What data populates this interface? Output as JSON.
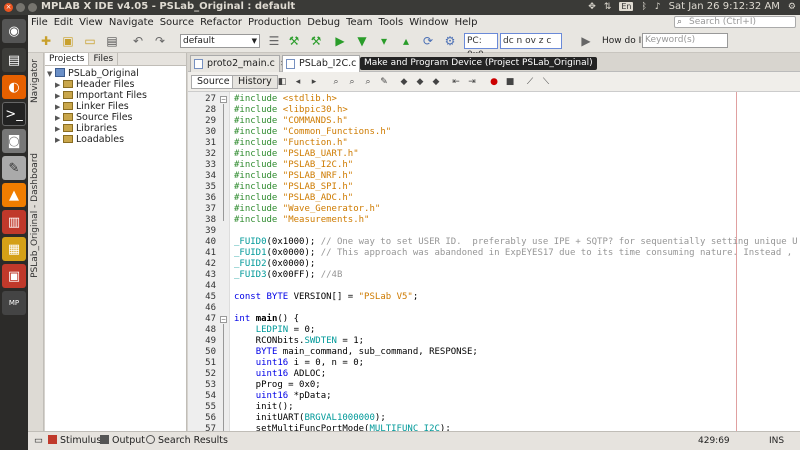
{
  "os_bar": {
    "window_title": "MPLAB X IDE v4.05 - PSLab_Original : default",
    "lang": "En",
    "clock": "Sat Jan 26  9:12:32 AM"
  },
  "menu": {
    "items": [
      "File",
      "Edit",
      "View",
      "Navigate",
      "Source",
      "Refactor",
      "Production",
      "Debug",
      "Team",
      "Tools",
      "Window",
      "Help"
    ],
    "search_placeholder": "Search (Ctrl+I)"
  },
  "toolbar": {
    "config_value": "default",
    "pc_label": "PC: 0x0",
    "status_bits": "dc n ov z c",
    "howdoi_label": "How do I?",
    "keyword_placeholder": "Keyword(s)"
  },
  "side_labels": {
    "navigator": "Navigator",
    "dashboard": "PSLab_Original - Dashboard"
  },
  "project_panel": {
    "tabs": [
      "Projects",
      "Files"
    ],
    "root": "PSLab_Original",
    "folders": [
      "Header Files",
      "Important Files",
      "Linker Files",
      "Source Files",
      "Libraries",
      "Loadables"
    ]
  },
  "editor": {
    "tabs": [
      "proto2_main.c",
      "PSLab_I2C.c"
    ],
    "tooltip": "Make and Program Device (Project PSLab_Original)",
    "view_buttons": [
      "Source",
      "History"
    ]
  },
  "code_lines": [
    {
      "n": "27",
      "t": [
        [
          "pp",
          "#include "
        ],
        [
          "str",
          "<stdlib.h>"
        ]
      ]
    },
    {
      "n": "28",
      "t": [
        [
          "pp",
          "#include "
        ],
        [
          "str",
          "<libpic30.h>"
        ]
      ]
    },
    {
      "n": "29",
      "t": [
        [
          "pp",
          "#include "
        ],
        [
          "str",
          "\"COMMANDS.h\""
        ]
      ]
    },
    {
      "n": "30",
      "t": [
        [
          "pp",
          "#include "
        ],
        [
          "str",
          "\"Common_Functions.h\""
        ]
      ]
    },
    {
      "n": "31",
      "t": [
        [
          "pp",
          "#include "
        ],
        [
          "str",
          "\"Function.h\""
        ]
      ]
    },
    {
      "n": "32",
      "t": [
        [
          "pp",
          "#include "
        ],
        [
          "str",
          "\"PSLAB_UART.h\""
        ]
      ]
    },
    {
      "n": "33",
      "t": [
        [
          "pp",
          "#include "
        ],
        [
          "str",
          "\"PSLAB_I2C.h\""
        ]
      ]
    },
    {
      "n": "34",
      "t": [
        [
          "pp",
          "#include "
        ],
        [
          "str",
          "\"PSLAB_NRF.h\""
        ]
      ]
    },
    {
      "n": "35",
      "t": [
        [
          "pp",
          "#include "
        ],
        [
          "str",
          "\"PSLAB_SPI.h\""
        ]
      ]
    },
    {
      "n": "36",
      "t": [
        [
          "pp",
          "#include "
        ],
        [
          "str",
          "\"PSLAB_ADC.h\""
        ]
      ]
    },
    {
      "n": "37",
      "t": [
        [
          "pp",
          "#include "
        ],
        [
          "str",
          "\"Wave_Generator.h\""
        ]
      ]
    },
    {
      "n": "38",
      "t": [
        [
          "pp",
          "#include "
        ],
        [
          "str",
          "\"Measurements.h\""
        ]
      ]
    },
    {
      "n": "39",
      "t": []
    },
    {
      "n": "40",
      "t": [
        [
          "id",
          "_FUID0"
        ],
        [
          "plain",
          "(0x1000); "
        ],
        [
          "cm",
          "// One way to set USER ID.  preferably use IPE + SQTP? for sequentially setting unique U"
        ]
      ]
    },
    {
      "n": "41",
      "t": [
        [
          "id",
          "_FUID1"
        ],
        [
          "plain",
          "(0x0000); "
        ],
        [
          "cm",
          "// This approach was abandoned in ExpEYES17 due to its time consuming nature. Instead ,"
        ]
      ]
    },
    {
      "n": "42",
      "t": [
        [
          "id",
          "_FUID2"
        ],
        [
          "plain",
          "(0x0000);"
        ]
      ]
    },
    {
      "n": "43",
      "t": [
        [
          "id",
          "_FUID3"
        ],
        [
          "plain",
          "(0x00FF); "
        ],
        [
          "cm",
          "//4B"
        ]
      ]
    },
    {
      "n": "44",
      "t": []
    },
    {
      "n": "45",
      "t": [
        [
          "kw",
          "const "
        ],
        [
          "typ",
          "BYTE "
        ],
        [
          "plain",
          "VERSION[] = "
        ],
        [
          "str",
          "\"PSLab V5\""
        ],
        [
          "plain",
          ";"
        ]
      ]
    },
    {
      "n": "46",
      "t": []
    },
    {
      "n": "47",
      "t": [
        [
          "kw",
          "int "
        ],
        [
          "fn",
          "main"
        ],
        [
          "plain",
          "() {"
        ]
      ]
    },
    {
      "n": "48",
      "t": [
        [
          "plain",
          "    "
        ],
        [
          "id",
          "LEDPIN"
        ],
        [
          "plain",
          " = 0;"
        ]
      ]
    },
    {
      "n": "49",
      "t": [
        [
          "plain",
          "    RCONbits."
        ],
        [
          "id",
          "SWDTEN"
        ],
        [
          "plain",
          " = 1;"
        ]
      ]
    },
    {
      "n": "50",
      "t": [
        [
          "plain",
          "    "
        ],
        [
          "typ",
          "BYTE "
        ],
        [
          "plain",
          "main_command, sub_command, RESPONSE;"
        ]
      ]
    },
    {
      "n": "51",
      "t": [
        [
          "plain",
          "    "
        ],
        [
          "typ",
          "uint16 "
        ],
        [
          "plain",
          "i = 0, n = 0;"
        ]
      ]
    },
    {
      "n": "52",
      "t": [
        [
          "plain",
          "    "
        ],
        [
          "typ",
          "uint16 "
        ],
        [
          "plain",
          "ADLOC;"
        ]
      ]
    },
    {
      "n": "53",
      "t": [
        [
          "plain",
          "    pProg = 0x0;"
        ]
      ]
    },
    {
      "n": "54",
      "t": [
        [
          "plain",
          "    "
        ],
        [
          "typ",
          "uint16 "
        ],
        [
          "plain",
          "*pData;"
        ]
      ]
    },
    {
      "n": "55",
      "t": [
        [
          "plain",
          "    init();"
        ]
      ]
    },
    {
      "n": "56",
      "t": [
        [
          "plain",
          "    initUART("
        ],
        [
          "id",
          "BRGVAL1000000"
        ],
        [
          "plain",
          ");"
        ]
      ]
    },
    {
      "n": "57",
      "t": [
        [
          "plain",
          "    setMultiFuncPortMode("
        ],
        [
          "id",
          "MULTIFUNC_I2C"
        ],
        [
          "plain",
          ");"
        ]
      ]
    }
  ],
  "bottom": {
    "tabs": [
      "Stimulus",
      "Output",
      "Search Results"
    ],
    "cursor_pos": "429:69",
    "mode": "INS"
  }
}
